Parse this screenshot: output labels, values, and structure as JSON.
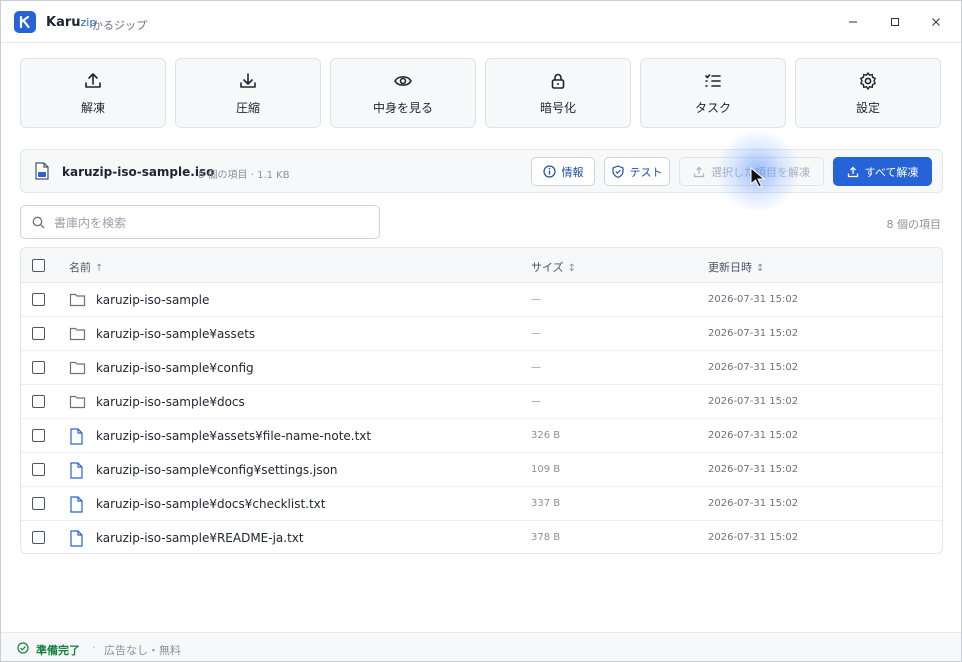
{
  "app": {
    "name": "Karu",
    "name_suffix": "zip",
    "subtitle": "かるジップ"
  },
  "window_controls": {
    "minimize": "—",
    "maximize": "☐",
    "close": "✕"
  },
  "toolbar": [
    {
      "label": "解凍",
      "icon": "upload-icon"
    },
    {
      "label": "圧縮",
      "icon": "download-icon"
    },
    {
      "label": "中身を見る",
      "icon": "eye-icon"
    },
    {
      "label": "暗号化",
      "icon": "lock-icon"
    },
    {
      "label": "タスク",
      "icon": "task-list-icon"
    },
    {
      "label": "設定",
      "icon": "gear-icon"
    }
  ],
  "archive": {
    "file_name": "karuzip-iso-sample.iso",
    "meta": "8 個の項目 · 1.1 KB",
    "info_label": "情報",
    "test_label": "テスト",
    "extract_selected_label": "選択した項目を解凍",
    "extract_all_label": "すべて解凍"
  },
  "search": {
    "placeholder": "書庫内を検索",
    "value": ""
  },
  "item_count": "8 個の項目",
  "table": {
    "headers": {
      "name": "名前",
      "size": "サイズ",
      "modified": "更新日時"
    },
    "sort_indicators": {
      "name": "↑",
      "size": "↕",
      "modified": "↕"
    },
    "rows": [
      {
        "type": "folder",
        "name": "karuzip-iso-sample",
        "size": "—",
        "modified": "2026-07-31 15:02"
      },
      {
        "type": "folder",
        "name": "karuzip-iso-sample¥assets",
        "size": "—",
        "modified": "2026-07-31 15:02"
      },
      {
        "type": "folder",
        "name": "karuzip-iso-sample¥config",
        "size": "—",
        "modified": "2026-07-31 15:02"
      },
      {
        "type": "folder",
        "name": "karuzip-iso-sample¥docs",
        "size": "—",
        "modified": "2026-07-31 15:02"
      },
      {
        "type": "file",
        "name": "karuzip-iso-sample¥assets¥file-name-note.txt",
        "size": "326 B",
        "modified": "2026-07-31 15:02"
      },
      {
        "type": "file",
        "name": "karuzip-iso-sample¥config¥settings.json",
        "size": "109 B",
        "modified": "2026-07-31 15:02"
      },
      {
        "type": "file",
        "name": "karuzip-iso-sample¥docs¥checklist.txt",
        "size": "337 B",
        "modified": "2026-07-31 15:02"
      },
      {
        "type": "file",
        "name": "karuzip-iso-sample¥README-ja.txt",
        "size": "378 B",
        "modified": "2026-07-31 15:02"
      }
    ]
  },
  "status": {
    "text": "準備完了",
    "separator": "·",
    "note": "広告なし・無料"
  },
  "colors": {
    "accent": "#2563d6",
    "status_ok": "#15803d"
  }
}
